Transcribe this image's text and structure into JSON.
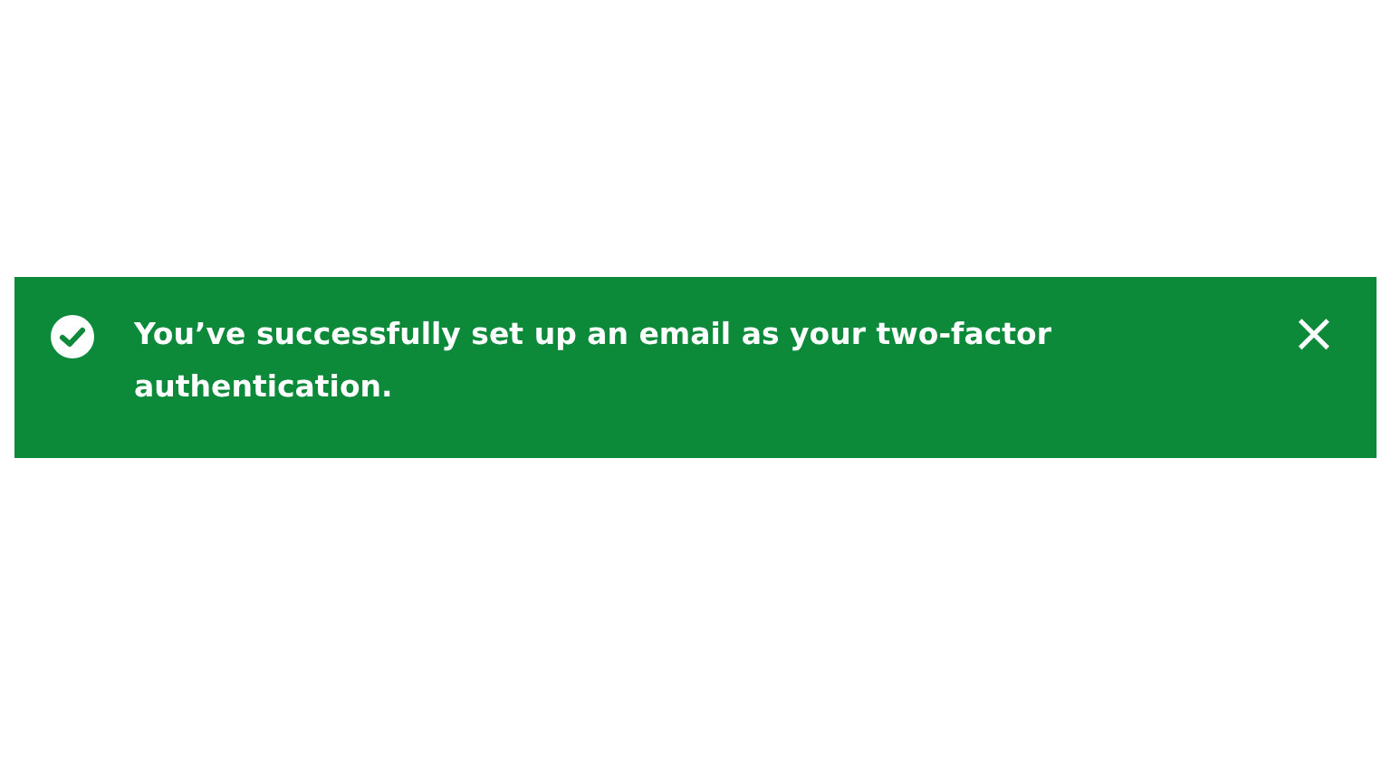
{
  "banner": {
    "message": "You’ve successfully set up an email as your two-factor authentication.",
    "close": "×"
  }
}
